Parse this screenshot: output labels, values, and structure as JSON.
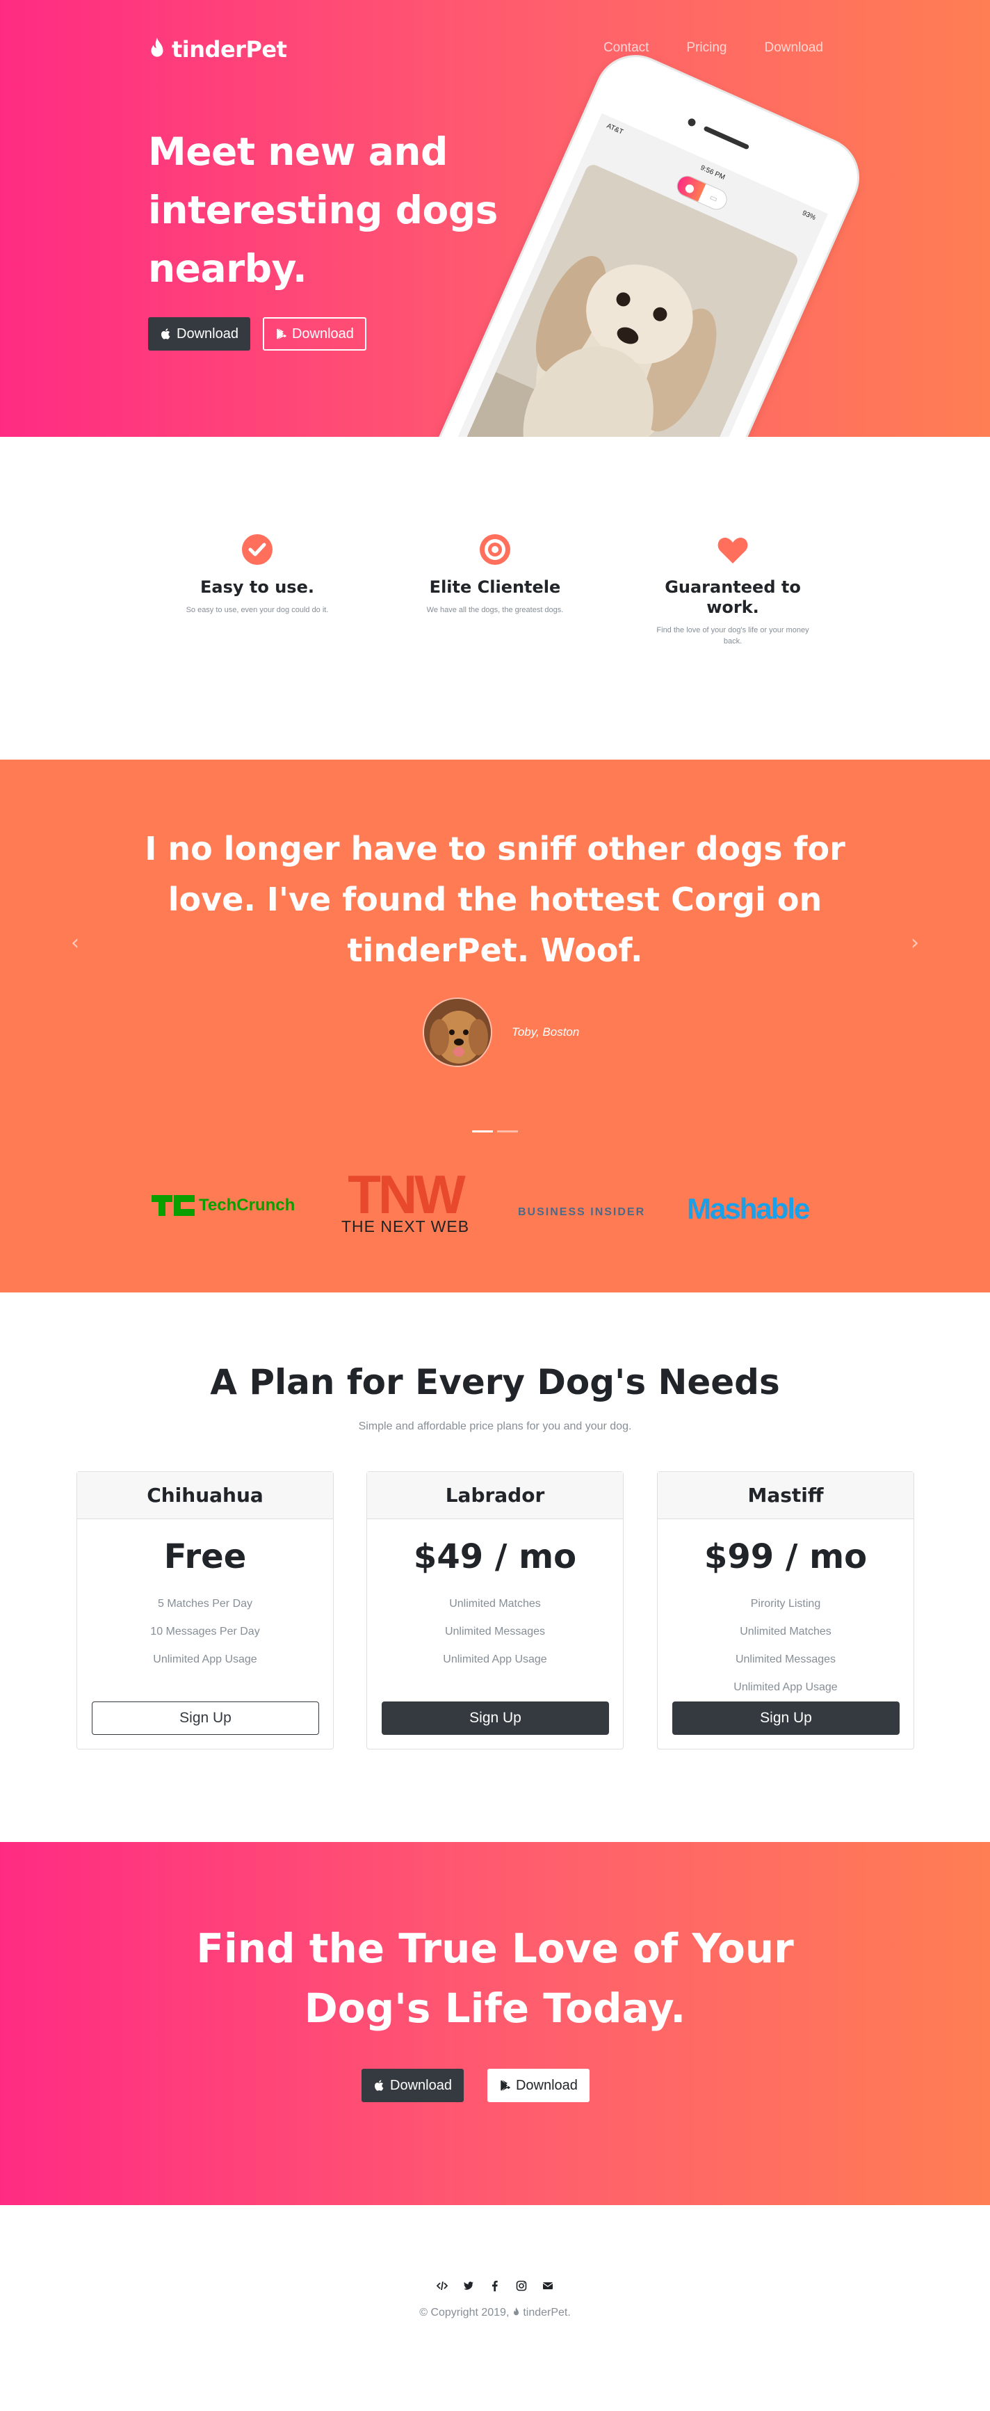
{
  "nav": {
    "brand": "tinderPet",
    "links": [
      "Contact",
      "Pricing",
      "Download"
    ]
  },
  "hero": {
    "title": "Meet new and interesting dogs nearby.",
    "apple_btn": "Download",
    "play_btn": "Download",
    "phone": {
      "carrier": "AT&T",
      "time": "9:56 PM",
      "battery": "93%"
    }
  },
  "features": [
    {
      "icon": "check-circle-icon",
      "title": "Easy to use.",
      "text": "So easy to use, even your dog could do it."
    },
    {
      "icon": "bullseye-icon",
      "title": "Elite Clientele",
      "text": "We have all the dogs, the greatest dogs."
    },
    {
      "icon": "heart-icon",
      "title": "Guaranteed to work.",
      "text": "Find the love of your dog's life or your money back."
    }
  ],
  "testimonial": {
    "quote": "I no longer have to sniff other dogs for love. I've found the hottest Corgi on tinderPet. Woof.",
    "author": "Toby, Boston"
  },
  "press": [
    "TechCrunch",
    "THE NEXT WEB",
    "BUSINESS INSIDER",
    "Mashable"
  ],
  "pricing": {
    "title": "A Plan for Every Dog's Needs",
    "subtitle": "Simple and affordable price plans for you and your dog.",
    "plans": [
      {
        "name": "Chihuahua",
        "price": "Free",
        "features": [
          "5 Matches Per Day",
          "10 Messages Per Day",
          "Unlimited App Usage"
        ],
        "button": "Sign Up"
      },
      {
        "name": "Labrador",
        "price": "$49 / mo",
        "features": [
          "Unlimited Matches",
          "Unlimited Messages",
          "Unlimited App Usage"
        ],
        "button": "Sign Up"
      },
      {
        "name": "Mastiff",
        "price": "$99 / mo",
        "features": [
          "Pirority Listing",
          "Unlimited Matches",
          "Unlimited Messages",
          "Unlimited App Usage"
        ],
        "button": "Sign Up"
      }
    ]
  },
  "cta": {
    "title": "Find the True Love of Your Dog's Life Today.",
    "apple_btn": "Download",
    "play_btn": "Download"
  },
  "footer": {
    "socials": [
      "code-icon",
      "twitter-icon",
      "facebook-icon",
      "instagram-icon",
      "envelope-icon"
    ],
    "copyright_prefix": "© Copyright 2019,",
    "copyright_brand": "tinderPet."
  },
  "colors": {
    "gradient_start": "#ff2b83",
    "gradient_end": "#ff7e53",
    "testimonial_bg": "#ff7b53",
    "accent": "#ff6f5b",
    "dark": "#343a40"
  }
}
